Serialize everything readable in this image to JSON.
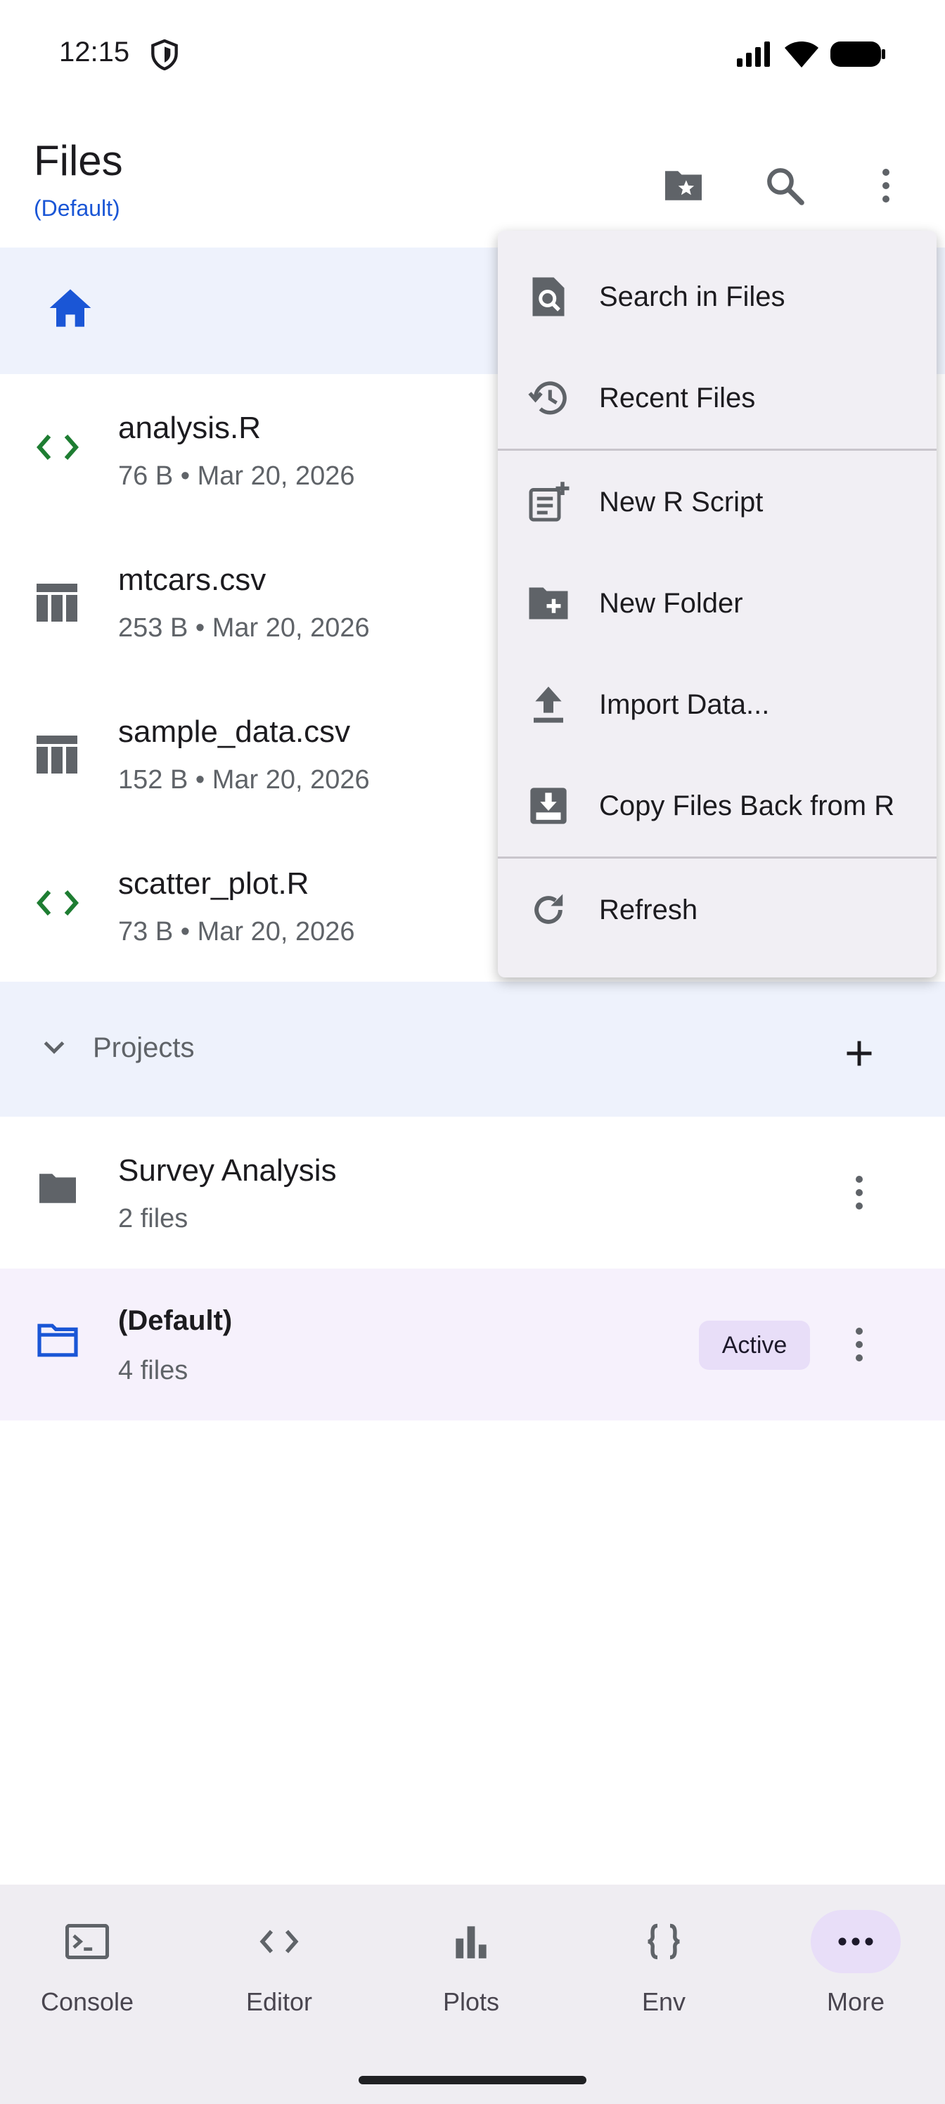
{
  "status_bar": {
    "time": "12:15"
  },
  "app_bar": {
    "title": "Files",
    "subtitle": "(Default)",
    "icons": [
      "folder-star-icon",
      "search-icon",
      "more-vert-icon"
    ]
  },
  "breadcrumb": {
    "icon": "home-icon"
  },
  "files": [
    {
      "name": "analysis.R",
      "meta": "76 B • Mar 20, 2026",
      "icon": "code-icon"
    },
    {
      "name": "mtcars.csv",
      "meta": "253 B • Mar 20, 2026",
      "icon": "table-icon"
    },
    {
      "name": "sample_data.csv",
      "meta": "152 B • Mar 20, 2026",
      "icon": "table-icon"
    },
    {
      "name": "scatter_plot.R",
      "meta": "73 B • Mar 20, 2026",
      "icon": "code-icon"
    }
  ],
  "projects": {
    "label": "Projects",
    "items": [
      {
        "name": "Survey Analysis",
        "meta": "2 files"
      },
      {
        "name": "(Default)",
        "meta": "4 files",
        "badge": "Active"
      }
    ]
  },
  "menu": {
    "items": [
      {
        "label": "Search in Files",
        "icon": "search-in-files-icon"
      },
      {
        "label": "Recent Files",
        "icon": "history-icon"
      },
      {
        "label": "New R Script",
        "icon": "new-script-icon"
      },
      {
        "label": "New Folder",
        "icon": "new-folder-icon"
      },
      {
        "label": "Import Data...",
        "icon": "upload-icon"
      },
      {
        "label": "Copy Files Back from R",
        "icon": "download-box-icon"
      },
      {
        "label": "Refresh",
        "icon": "refresh-icon"
      }
    ]
  },
  "bottom_nav": {
    "items": [
      {
        "label": "Console",
        "icon": "terminal-icon"
      },
      {
        "label": "Editor",
        "icon": "code-icon"
      },
      {
        "label": "Plots",
        "icon": "bar-chart-icon"
      },
      {
        "label": "Env",
        "icon": "braces-icon"
      },
      {
        "label": "More",
        "icon": "more-horiz-icon",
        "selected": true
      }
    ]
  },
  "colors": {
    "accent_blue": "#1a56d6",
    "code_green": "#1e7d32",
    "band_bg": "#eef2fc",
    "active_bg": "#f6f1fc",
    "badge_bg": "#e8def8"
  }
}
